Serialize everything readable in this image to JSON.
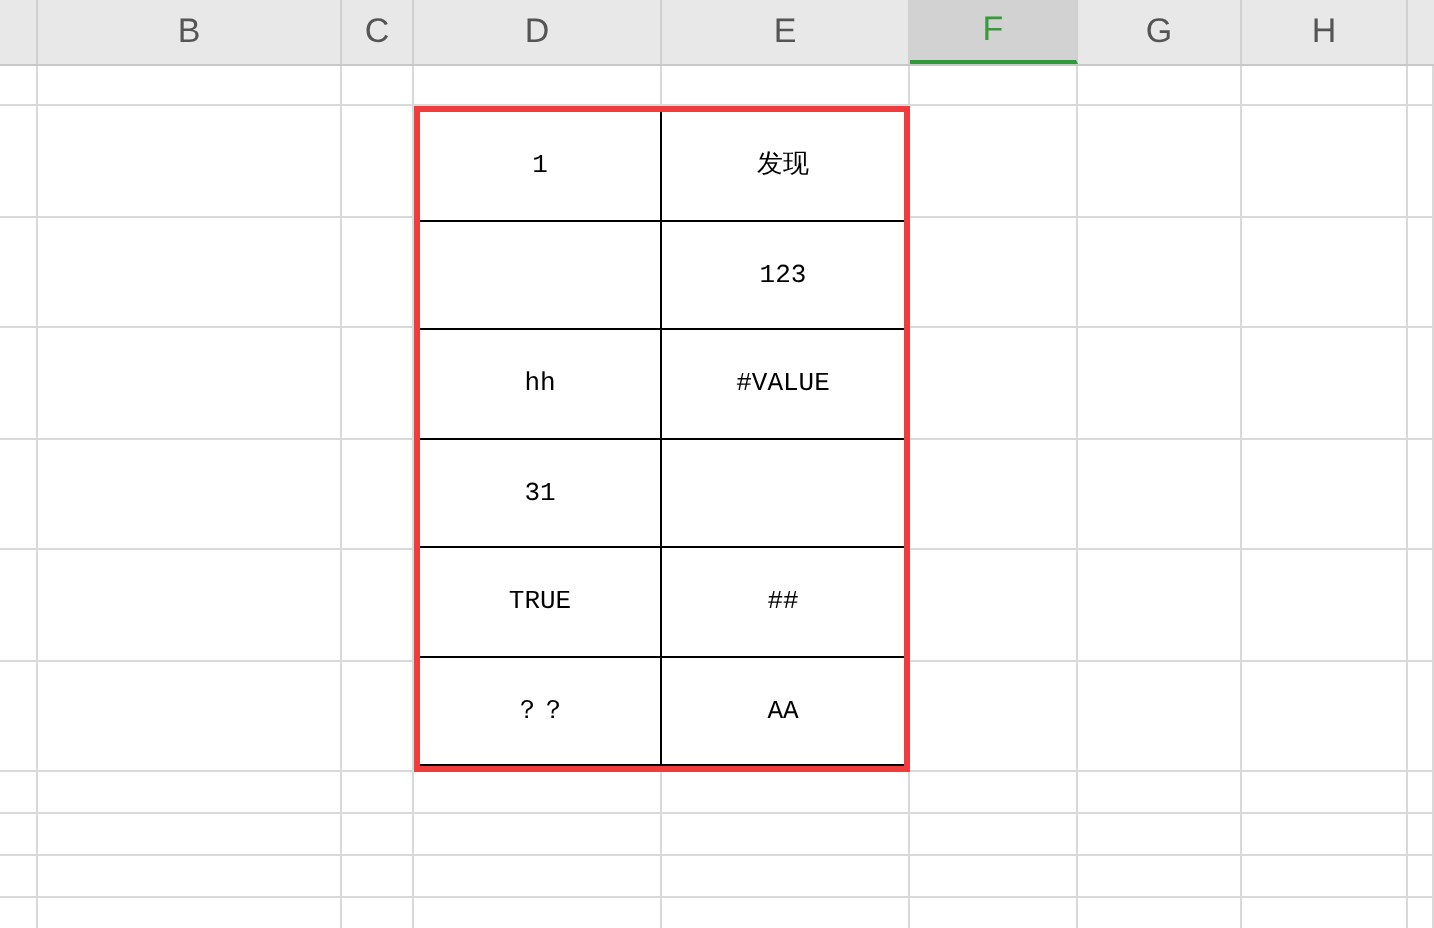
{
  "columns": [
    {
      "label": "B",
      "selected": false
    },
    {
      "label": "C",
      "selected": false
    },
    {
      "label": "D",
      "selected": false
    },
    {
      "label": "E",
      "selected": false
    },
    {
      "label": "F",
      "selected": true
    },
    {
      "label": "G",
      "selected": false
    },
    {
      "label": "H",
      "selected": false
    }
  ],
  "table": {
    "rows": [
      {
        "D": "1",
        "E": "发现"
      },
      {
        "E": "123"
      },
      {
        "D": "hh",
        "E": "#VALUE"
      },
      {
        "D": "31"
      },
      {
        "D": "TRUE",
        "E": "##"
      },
      {
        "D": "？？",
        "E": "AA"
      }
    ]
  }
}
